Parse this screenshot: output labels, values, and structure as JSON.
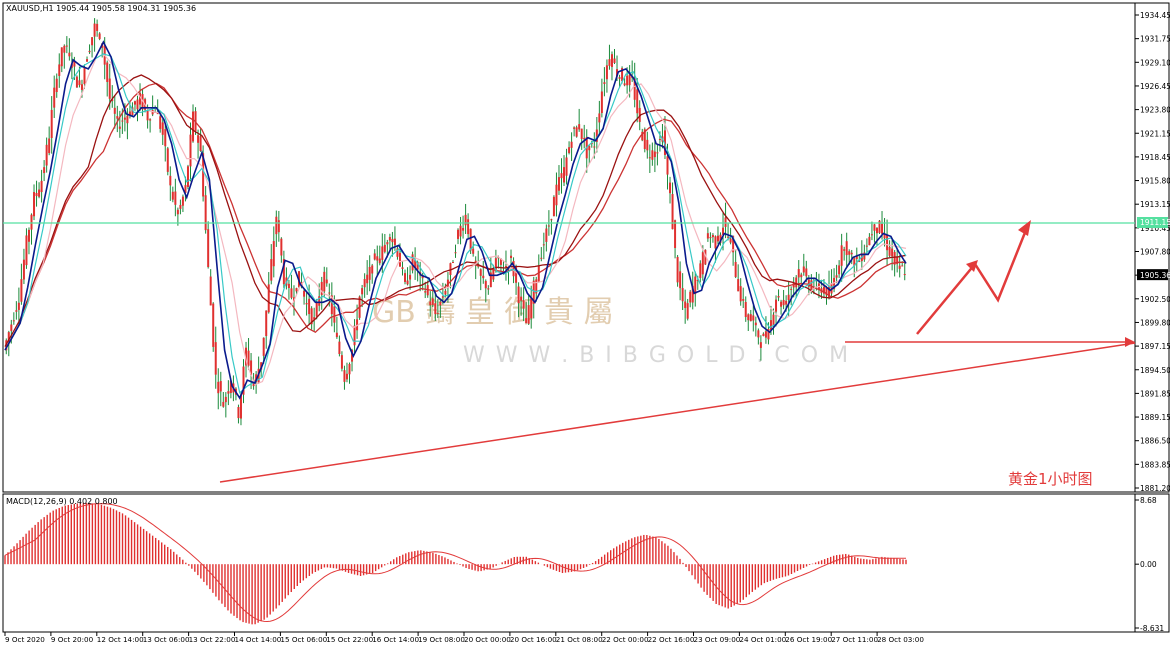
{
  "header": {
    "symbol_info": "XAUUSD,H1  1905.44 1905.58 1904.31 1905.36",
    "macd_info": "MACD(12,26,9) 0.402 0.800"
  },
  "annotation": {
    "note": "黄金1小时图",
    "watermark": "W W W . B I B G O L D . C O M",
    "watermark_logo": "GB 鑄 皇 御 貴 屬"
  },
  "colors": {
    "candle": "#e0302f",
    "price_wick": "#1a8a3a",
    "ma_fast": "#0a1a8c",
    "ma_mid": "#38c9c7",
    "ma_slow": "#f4b8c0",
    "ma_long1": "#9a1111",
    "ma_long2": "#cc3333",
    "hline": "#55e0a0",
    "trend": "#e23b3b",
    "macd_bar": "#e0302f",
    "macd_signal": "#e23b3b"
  },
  "chart_data": [
    {
      "type": "candlestick",
      "title": "XAUUSD,H1",
      "price_axis_ticks": [
        "1934.45",
        "1931.75",
        "1929.10",
        "1926.45",
        "1923.80",
        "1921.15",
        "1918.45",
        "1915.80",
        "1913.15",
        "1910.45",
        "1907.80",
        "1905.36",
        "1902.50",
        "1899.80",
        "1897.15",
        "1894.50",
        "1891.85",
        "1889.15",
        "1886.50",
        "1883.85",
        "1881.20"
      ],
      "current_price": "1905.36",
      "horizontal_line_label": "1911.15",
      "x_ticks": [
        "9 Oct 2020",
        "9 Oct 20:00",
        "12 Oct 14:00",
        "13 Oct 06:00",
        "13 Oct 22:00",
        "14 Oct 14:00",
        "15 Oct 06:00",
        "15 Oct 22:00",
        "16 Oct 14:00",
        "19 Oct 08:00",
        "20 Oct 00:00",
        "20 Oct 16:00",
        "21 Oct 08:00",
        "22 Oct 00:00",
        "22 Oct 16:00",
        "23 Oct 09:00",
        "24 Oct 01:00",
        "26 Oct 19:00",
        "27 Oct 11:00",
        "28 Oct 03:00"
      ],
      "ylim": [
        1881.2,
        1934.45
      ],
      "price_path": [
        1896,
        1899,
        1902,
        1908,
        1913,
        1915,
        1920,
        1927,
        1930,
        1928,
        1925,
        1929,
        1932,
        1930,
        1924,
        1921,
        1922,
        1923,
        1924,
        1922,
        1923,
        1920,
        1914,
        1911,
        1914,
        1922,
        1918,
        1905,
        1893,
        1890,
        1893,
        1889,
        1896,
        1892,
        1895,
        1903,
        1911,
        1904,
        1902,
        1904,
        1901,
        1899,
        1904,
        1902,
        1897,
        1893,
        1896,
        1902,
        1904,
        1906,
        1907,
        1909,
        1907,
        1903,
        1906,
        1904,
        1902,
        1900,
        1902,
        1905,
        1909,
        1911,
        1906,
        1904,
        1903,
        1906,
        1905,
        1906,
        1902,
        1899,
        1903,
        1907,
        1910,
        1914,
        1916,
        1920,
        1921,
        1918,
        1919,
        1925,
        1929,
        1927,
        1926,
        1926,
        1921,
        1918,
        1918,
        1920,
        1913,
        1904,
        1900,
        1903,
        1905,
        1909,
        1908,
        1910,
        1908,
        1903,
        1900,
        1899,
        1897,
        1898,
        1902,
        1901,
        1903,
        1905,
        1904,
        1903,
        1903,
        1902,
        1905,
        1908,
        1906,
        1906,
        1908,
        1910,
        1909,
        1907,
        1905,
        1905
      ],
      "moving_averages": [
        "ma_fast",
        "ma_mid",
        "ma_slow",
        "ma_long1",
        "ma_long2"
      ]
    },
    {
      "type": "bar",
      "title": "MACD(12,26,9)",
      "values_label": [
        "0.402",
        "0.800"
      ],
      "axis_ticks": [
        "8.68",
        "0.00",
        "-8.631"
      ],
      "ylim": [
        -8.631,
        8.68
      ],
      "values": [
        1.2,
        2.8,
        4.5,
        6.0,
        7.2,
        7.9,
        8.2,
        8.3,
        8.1,
        7.6,
        6.8,
        5.6,
        4.4,
        3.2,
        2.0,
        0.6,
        -1.0,
        -2.8,
        -4.8,
        -6.6,
        -7.8,
        -8.2,
        -7.4,
        -5.8,
        -4.0,
        -2.4,
        -1.2,
        -0.4,
        -0.6,
        -1.2,
        -1.6,
        -1.2,
        -0.2,
        0.9,
        1.6,
        1.9,
        1.6,
        1.0,
        0.2,
        -0.6,
        -1.0,
        -0.6,
        0.3,
        1.0,
        1.0,
        0.2,
        -0.6,
        -1.2,
        -1.0,
        -0.4,
        0.6,
        1.8,
        2.8,
        3.6,
        4.0,
        3.6,
        2.4,
        0.6,
        -1.6,
        -3.8,
        -5.4,
        -6.0,
        -5.2,
        -3.8,
        -2.6,
        -2.0,
        -1.6,
        -0.8,
        0.0,
        0.6,
        1.2,
        1.4,
        0.8,
        0.6,
        1.0,
        0.8,
        0.6
      ]
    }
  ]
}
